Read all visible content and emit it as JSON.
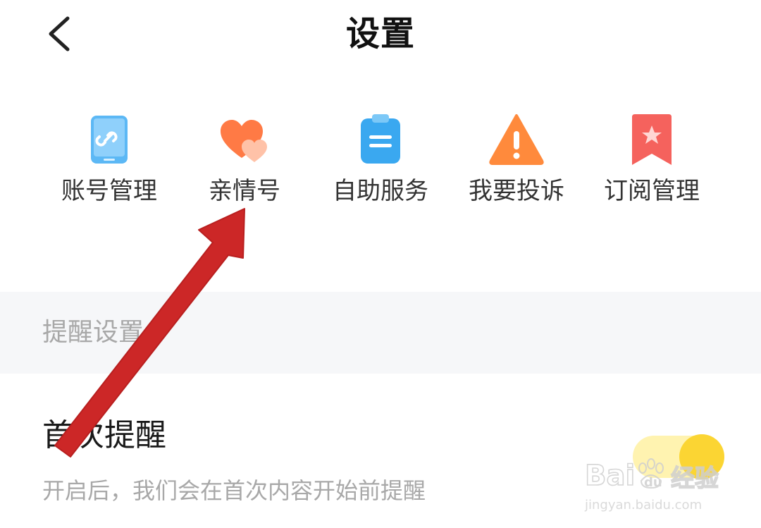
{
  "header": {
    "title": "设置"
  },
  "quick_entries": [
    {
      "label": "账号管理",
      "icon": "phone-link-icon"
    },
    {
      "label": "亲情号",
      "icon": "hearts-icon"
    },
    {
      "label": "自助服务",
      "icon": "clipboard-icon"
    },
    {
      "label": "我要投诉",
      "icon": "warning-icon"
    },
    {
      "label": "订阅管理",
      "icon": "bookmark-star-icon"
    }
  ],
  "section": {
    "title": "提醒设置"
  },
  "setting": {
    "title": "首次提醒",
    "description": "开启后，我们会在首次内容开始前提醒",
    "enabled": true
  },
  "colors": {
    "arrow": "#cc2727",
    "toggle_knob": "#fbd533",
    "toggle_track": "#fff3b0",
    "account_icon": "#5cb8f5",
    "family_icon": "#ff7a45",
    "service_icon": "#3aa8f0",
    "complaint_icon": "#ff8a3c",
    "subscribe_icon": "#f5625d"
  },
  "watermark": {
    "brand": "Baidu经验",
    "url": "jingyan.baidu.com"
  }
}
